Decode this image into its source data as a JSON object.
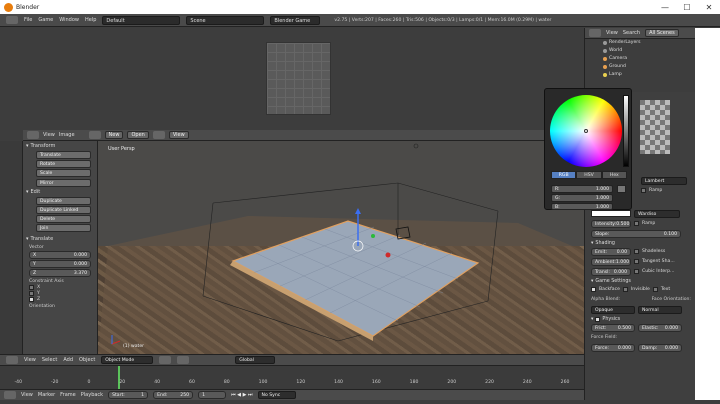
{
  "window": {
    "title": "Blender",
    "minimize": "—",
    "maximize": "☐",
    "close": "✕"
  },
  "topbar": {
    "menus": [
      "File",
      "Game",
      "Window",
      "Help"
    ],
    "layout": "Default",
    "scene": "Scene",
    "engine": "Blender Game",
    "stats": "v2.75 | Verts:207 | Faces:260 | Tris:506 | Objects:0/3 | Lamps:0/1 | Mem:16.0M (0.29M) | water"
  },
  "image_header": {
    "menus": [
      "View",
      "Image"
    ],
    "new": "New",
    "open": "Open",
    "view": "View"
  },
  "left_panel": {
    "transform_title": "Transform",
    "transform_buttons": [
      "Translate",
      "Rotate",
      "Scale",
      "Mirror"
    ],
    "edit_title": "Edit",
    "edit_buttons": [
      "Duplicate",
      "Duplicate Linked",
      "Delete",
      "Join"
    ],
    "translate_title": "Translate",
    "vector_label": "Vector",
    "vector": [
      {
        "axis": "X",
        "value": "0.000"
      },
      {
        "axis": "Y",
        "value": "0.000"
      },
      {
        "axis": "Z",
        "value": "3.370"
      }
    ],
    "constraint_label": "Constraint Axis",
    "axes": [
      "X",
      "Y",
      "Z"
    ],
    "orientation_label": "Orientation"
  },
  "viewport": {
    "label": "User Persp",
    "object_label": "(1) water"
  },
  "viewport_menu": {
    "items": [
      "View",
      "Select",
      "Add",
      "Object"
    ],
    "mode": "Object Mode",
    "orientation": "Global"
  },
  "timeline": {
    "ticks": [
      "-40",
      "-20",
      "0",
      "20",
      "40",
      "60",
      "80",
      "100",
      "120",
      "140",
      "160",
      "180",
      "200",
      "220",
      "240",
      "260"
    ],
    "menus": [
      "View",
      "Marker",
      "Frame",
      "Playback"
    ],
    "start_label": "Start:",
    "start": "1",
    "end_label": "End:",
    "end": "250",
    "current": "1",
    "sync": "No Sync"
  },
  "outliner": {
    "menus": [
      "View",
      "Search",
      "All Scenes"
    ],
    "items": [
      {
        "label": "RenderLayers",
        "color": "#9a9a9a"
      },
      {
        "label": "World",
        "color": "#9a9a9a"
      },
      {
        "label": "Camera",
        "color": "#e8a050"
      },
      {
        "label": "Ground",
        "color": "#e8a050"
      },
      {
        "label": "Lamp",
        "color": "#e8d050"
      }
    ]
  },
  "color_picker": {
    "tabs": [
      "RGB",
      "HSV",
      "Hex"
    ],
    "active_tab": "RGB",
    "channels": [
      {
        "label": "R:",
        "value": "1.000"
      },
      {
        "label": "G:",
        "value": "1.000"
      },
      {
        "label": "B:",
        "value": "1.000"
      }
    ]
  },
  "properties": {
    "diffuse_shader": "Lambert",
    "ramp_label": "Ramp",
    "specular_shader": "Wardiso",
    "intensity_label": "Intensity:",
    "intensity": "0.500",
    "slope_label": "Slope:",
    "slope": "0.100",
    "shading_title": "Shading",
    "emit_label": "Emit:",
    "emit": "0.00",
    "shadeless": "Shadeless",
    "ambient_label": "Ambient:",
    "ambient": "1.000",
    "tangent": "Tangent Sha...",
    "translucency_label": "Transl:",
    "translucency": "0.000",
    "cubic": "Cubic Interp...",
    "game_title": "Game Settings",
    "backface": "Backface",
    "invisible": "Invisible",
    "text": "Text",
    "alpha_label": "Alpha Blend:",
    "alpha": "Opaque",
    "face_label": "Face Orientation:",
    "face": "Normal",
    "physics_title": "Physics",
    "friction_label": "Frict:",
    "friction": "0.500",
    "elastic_label": "Elastic:",
    "elastic": "0.000",
    "force_label": "Force Field:",
    "force_label2": "Force:",
    "force": "0.000",
    "damp_label": "Damp:",
    "damp": "0.000"
  },
  "colors": {
    "accent": "#5680c2",
    "plane": "#a8b4c4",
    "grid": "#e0a060"
  }
}
